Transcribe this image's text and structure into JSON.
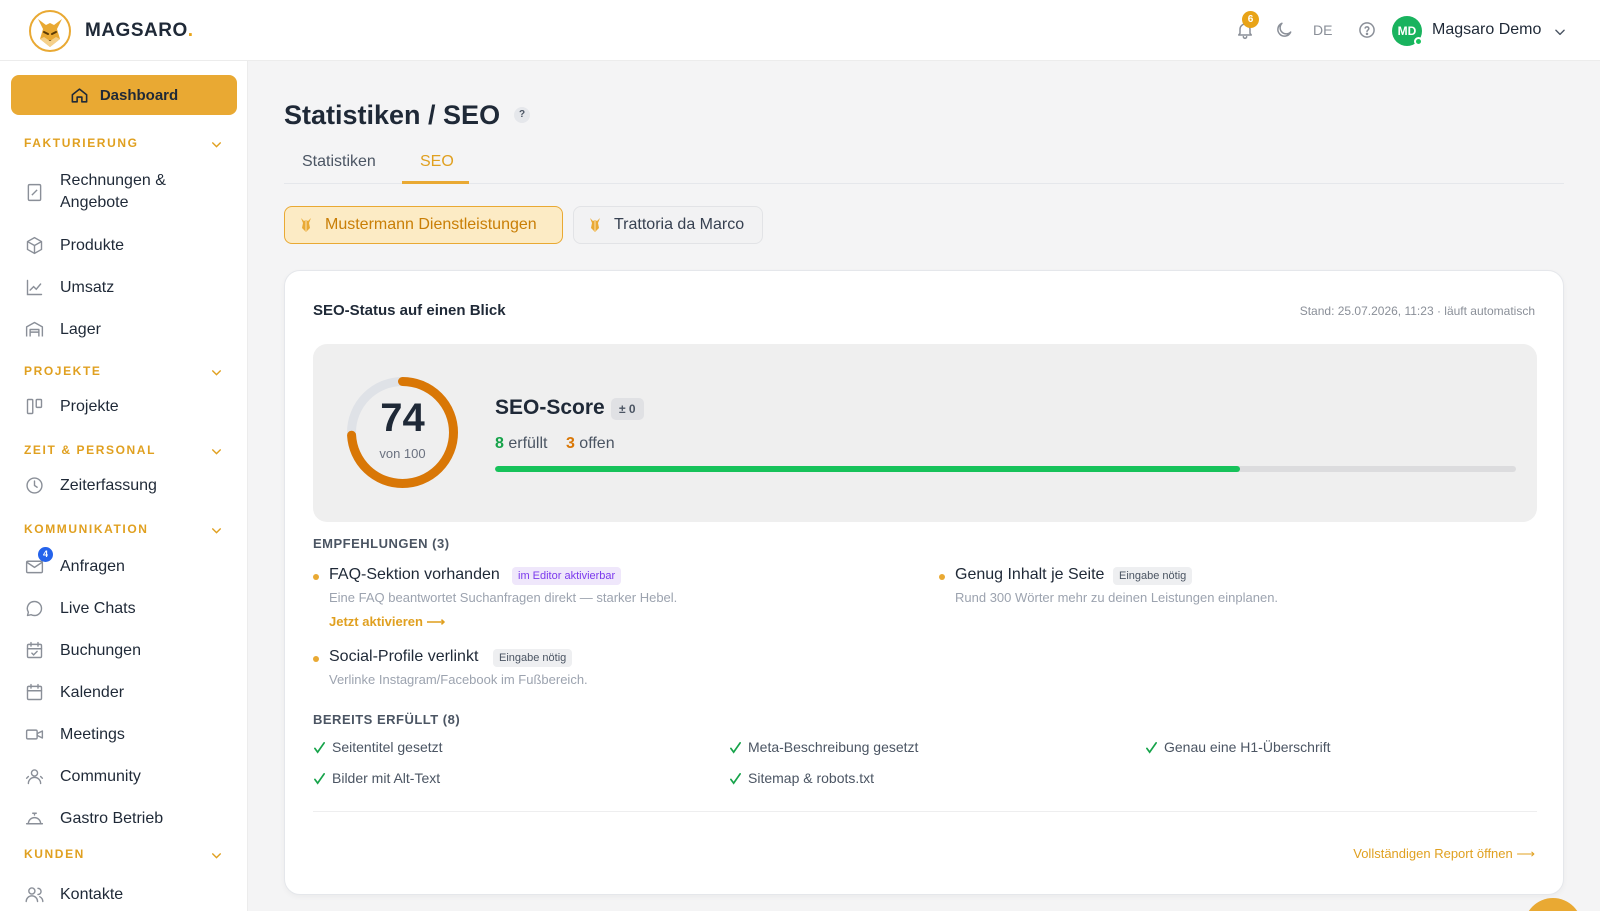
{
  "app": {
    "brand": "MAGSARO",
    "brand_dot": "."
  },
  "topbar": {
    "notification_count": "6",
    "language": "DE",
    "user_initials": "MD",
    "user_name": "Magsaro Demo"
  },
  "sidebar": {
    "dashboard_label": "Dashboard",
    "sections": [
      {
        "title": "FAKTURIERUNG",
        "items": [
          {
            "label": "Rechnungen &",
            "label2": "Angebote",
            "icon": "invoice-icon"
          },
          {
            "label": "Produkte",
            "icon": "box-icon"
          },
          {
            "label": "Umsatz",
            "icon": "chart-line-icon"
          },
          {
            "label": "Lager",
            "icon": "warehouse-icon"
          }
        ]
      },
      {
        "title": "PROJEKTE",
        "items": [
          {
            "label": "Projekte",
            "icon": "kanban-icon"
          }
        ]
      },
      {
        "title": "ZEIT & PERSONAL",
        "items": [
          {
            "label": "Zeiterfassung",
            "icon": "clock-icon"
          }
        ]
      },
      {
        "title": "KOMMUNIKATION",
        "items": [
          {
            "label": "Anfragen",
            "icon": "mail-icon",
            "badge": "4"
          },
          {
            "label": "Live Chats",
            "icon": "chat-icon"
          },
          {
            "label": "Buchungen",
            "icon": "booking-icon"
          },
          {
            "label": "Kalender",
            "icon": "calendar-icon"
          },
          {
            "label": "Meetings",
            "icon": "video-icon"
          },
          {
            "label": "Community",
            "icon": "community-icon"
          },
          {
            "label": "Gastro Betrieb",
            "icon": "cloche-icon"
          }
        ]
      },
      {
        "title": "KUNDEN",
        "items": [
          {
            "label": "Kontakte",
            "icon": "contacts-icon"
          }
        ]
      }
    ]
  },
  "main": {
    "title": "Statistiken / SEO",
    "help": "?",
    "tabs": [
      {
        "label": "Statistiken",
        "active": false
      },
      {
        "label": "SEO",
        "active": true
      }
    ],
    "sites": [
      {
        "label": "Mustermann Dienstleistungen",
        "active": true
      },
      {
        "label": "Trattoria da Marco",
        "active": false
      }
    ]
  },
  "seo": {
    "card_title": "SEO-Status auf einen Blick",
    "stand": "Stand: 25.07.2026, 11:23 · läuft automatisch",
    "score": 74,
    "score_max": "von 100",
    "score_label": "SEO-Score",
    "delta": "± 0",
    "fulfilled_count": "8",
    "fulfilled_label": "erfüllt",
    "open_count": "3",
    "open_label": "offen",
    "progress_fraction": 0.73,
    "recommendations_title": "EMPFEHLUNGEN (3)",
    "recommendations": [
      {
        "title": "FAQ-Sektion vorhanden",
        "tag": "im Editor aktivierbar",
        "desc": "Eine FAQ beantwortet Suchanfragen direkt — starker Hebel.",
        "action": "Jetzt aktivieren ⟶"
      },
      {
        "title": "Genug Inhalt je Seite",
        "tag": "Eingabe nötig",
        "desc": "Rund 300 Wörter mehr zu deinen Leistungen einplanen."
      },
      {
        "title": "Social-Profile verlinkt",
        "tag": "Eingabe nötig",
        "desc": "Verlinke Instagram/Facebook im Fußbereich."
      }
    ],
    "done_title": "BEREITS ERFÜLLT (8)",
    "done": [
      "Seitentitel gesetzt",
      "Meta-Beschreibung gesetzt",
      "Genau eine H1-Überschrift",
      "Bilder mit Alt-Text",
      "Sitemap & robots.txt"
    ],
    "report_link": "Vollständigen Report öffnen ⟶"
  },
  "colors": {
    "accent": "#e9a933",
    "accent_text": "#e0a020",
    "success": "#16c25a",
    "score_ring": "#d97706"
  }
}
